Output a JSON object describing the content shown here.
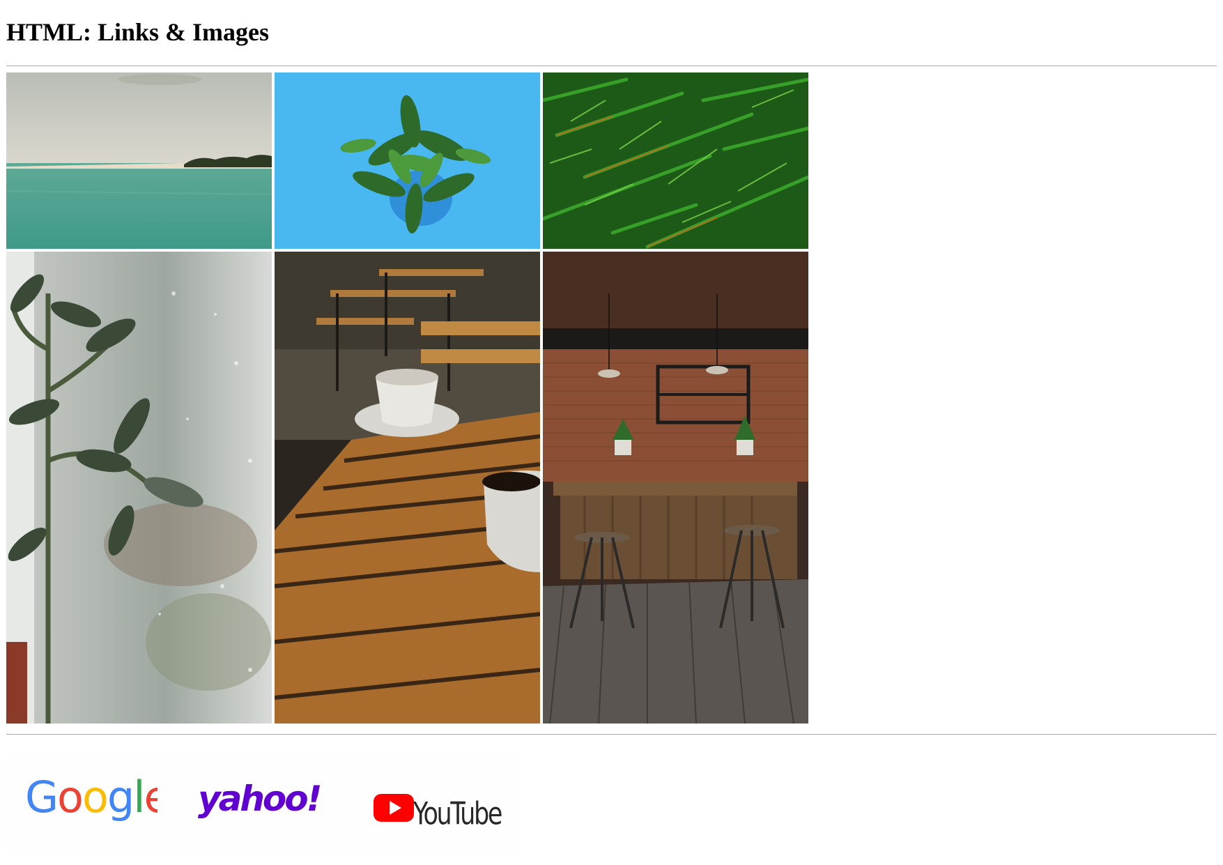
{
  "page": {
    "title": "HTML: Links & Images"
  },
  "gallery": {
    "images": [
      {
        "name": "sea-coast-photo",
        "subject": "calm turquoise sea with sandy coastline and trees"
      },
      {
        "name": "potted-plant-photo",
        "subject": "green potted plant seen from above on blue background"
      },
      {
        "name": "pine-branches-photo",
        "subject": "green fir branches"
      },
      {
        "name": "plant-by-window-photo",
        "subject": "succulent plant by a rainy window"
      },
      {
        "name": "coffee-table-photo",
        "subject": "coffee cups on wooden outdoor cafe table"
      },
      {
        "name": "cafe-interior-photo",
        "subject": "rustic wooden bar with stools and brick wall"
      }
    ]
  },
  "links": [
    {
      "name": "google-link",
      "logo": "google-logo",
      "text": "Google",
      "colors": [
        "#4285F4",
        "#EA4335",
        "#FBBC05",
        "#4285F4",
        "#34A853",
        "#EA4335"
      ]
    },
    {
      "name": "yahoo-link",
      "logo": "yahoo-logo",
      "text": "yahoo!",
      "color": "#6001D2"
    },
    {
      "name": "youtube-link",
      "logo": "youtube-logo",
      "text": "YouTube",
      "color": "#FF0000"
    }
  ]
}
